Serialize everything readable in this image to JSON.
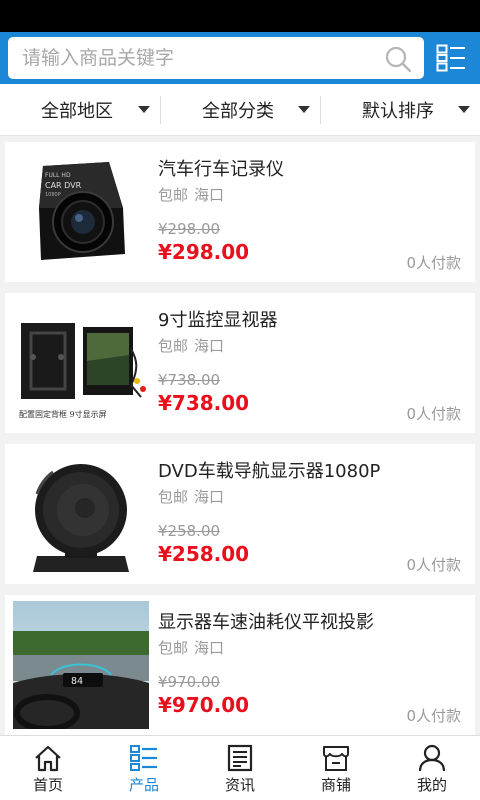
{
  "search": {
    "placeholder": "请输入商品关键字"
  },
  "filters": [
    {
      "label": "全部地区"
    },
    {
      "label": "全部分类"
    },
    {
      "label": "默认排序"
    }
  ],
  "products": [
    {
      "name": "汽车行车记录仪",
      "shipping": "包邮",
      "location": "海口",
      "old_price": "¥298.00",
      "price": "¥298.00",
      "buyers": "0人付款",
      "thumb_text": {
        "line1": "FULL HD",
        "line2": "CAR DVR",
        "line3": "1080P"
      }
    },
    {
      "name": "9寸监控显视器",
      "shipping": "包邮",
      "location": "海口",
      "old_price": "¥738.00",
      "price": "¥738.00",
      "buyers": "0人付款",
      "thumb_text": {
        "caption": "配置固定背框 9寸显示屏"
      }
    },
    {
      "name": "DVD车载导航显示器1080P",
      "shipping": "包邮",
      "location": "海口",
      "old_price": "¥258.00",
      "price": "¥258.00",
      "buyers": "0人付款"
    },
    {
      "name": "显示器车速油耗仪平视投影",
      "shipping": "包邮",
      "location": "海口",
      "old_price": "¥970.00",
      "price": "¥970.00",
      "buyers": "0人付款",
      "thumb_text": {
        "hud": "84"
      }
    }
  ],
  "tabs": [
    {
      "label": "首页",
      "icon": "home-icon"
    },
    {
      "label": "产品",
      "icon": "list-icon",
      "active": true
    },
    {
      "label": "资讯",
      "icon": "news-icon"
    },
    {
      "label": "商铺",
      "icon": "store-icon"
    },
    {
      "label": "我的",
      "icon": "user-icon"
    }
  ],
  "colors": {
    "brand": "#1b87d6",
    "price": "#e8101c",
    "muted": "#9a9a9a"
  }
}
